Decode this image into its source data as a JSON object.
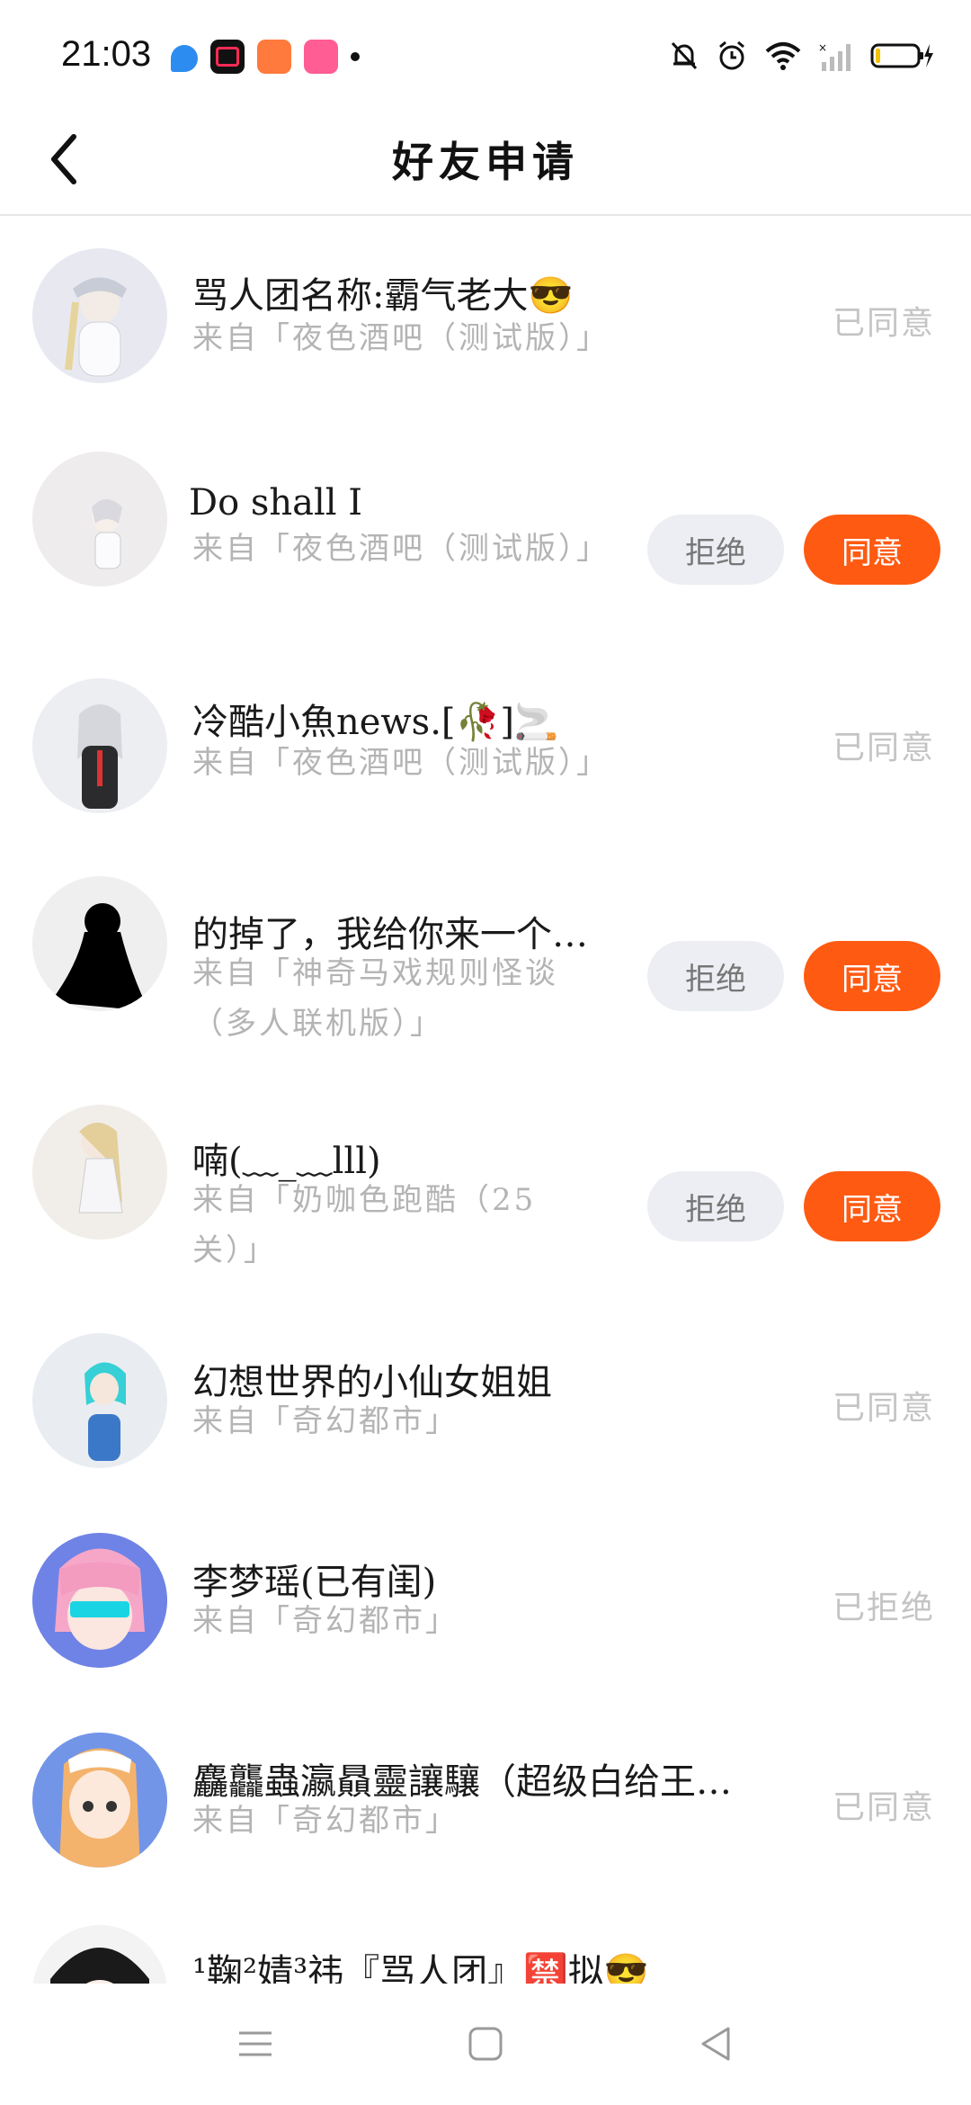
{
  "status_bar": {
    "time": "21:03"
  },
  "header": {
    "title": "好友申请"
  },
  "requests": [
    {
      "name": "骂人团名称:霸气老大😎",
      "from": "来自「夜色酒吧（测试版）」",
      "status": "已同意"
    },
    {
      "name": "Do shall I",
      "from": "来自「夜色酒吧（测试版）」",
      "reject": "拒绝",
      "accept": "同意"
    },
    {
      "name": "冷酷小魚news.[🥀]🚬",
      "from": "来自「夜色酒吧（测试版）」",
      "status": "已同意"
    },
    {
      "name": "的掉了，我给你来一个…",
      "from": "来自「神奇马戏规则怪谈（多人联机版）」",
      "reject": "拒绝",
      "accept": "同意"
    },
    {
      "name": "喃(﹏_﹏lll)",
      "from": "来自「奶咖色跑酷（25关）」",
      "reject": "拒绝",
      "accept": "同意"
    },
    {
      "name": "幻想世界的小仙女姐姐",
      "from": "来自「奇幻都市」",
      "status": "已同意"
    },
    {
      "name": "李梦瑶(已有闺)",
      "from": "来自「奇幻都市」",
      "status": "已拒绝"
    },
    {
      "name": "麤龘蟲瀛贔靈讓驤（超级白给王…",
      "from": "来自「奇幻都市」",
      "status": "已同意"
    },
    {
      "name": "¹鞠²婧³祎『骂人团』🈲拟😎",
      "from": "",
      "status": ""
    }
  ]
}
